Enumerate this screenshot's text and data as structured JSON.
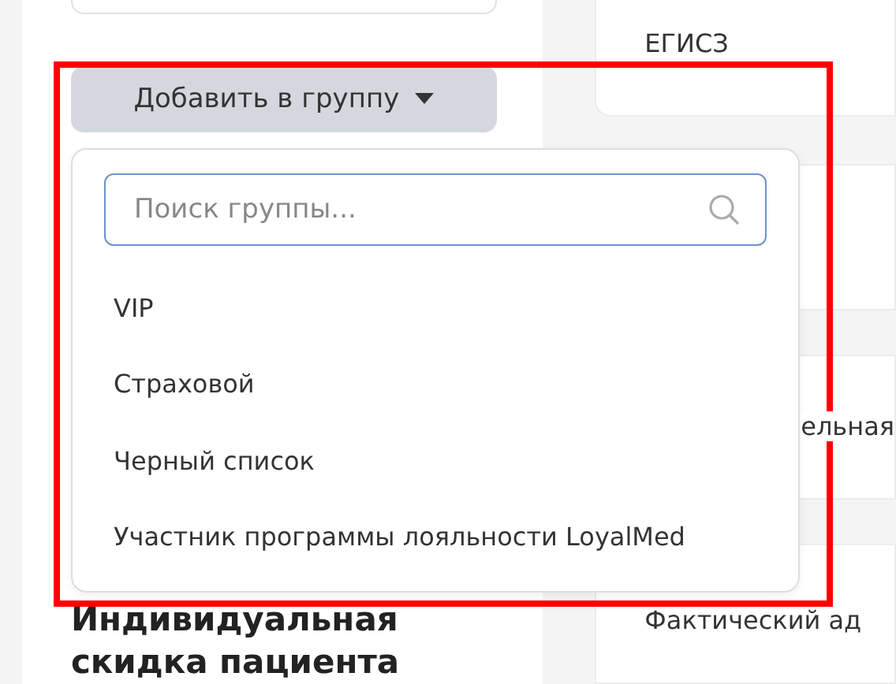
{
  "group_button": {
    "label": "Добавить в группу",
    "expanded": true
  },
  "group_menu": {
    "search": {
      "placeholder": "Поиск группы..."
    },
    "items": [
      {
        "label": "VIP"
      },
      {
        "label": "Страховой"
      },
      {
        "label": "Черный список"
      },
      {
        "label": "Участник программы лояльности LoyalMed"
      }
    ]
  },
  "discount_heading": "Индивидуальная скидка пациента",
  "right_panel": {
    "egisz_label": "ЕГИСЗ",
    "field_label_partial": "ельная",
    "address_label": "Фактический ад"
  }
}
